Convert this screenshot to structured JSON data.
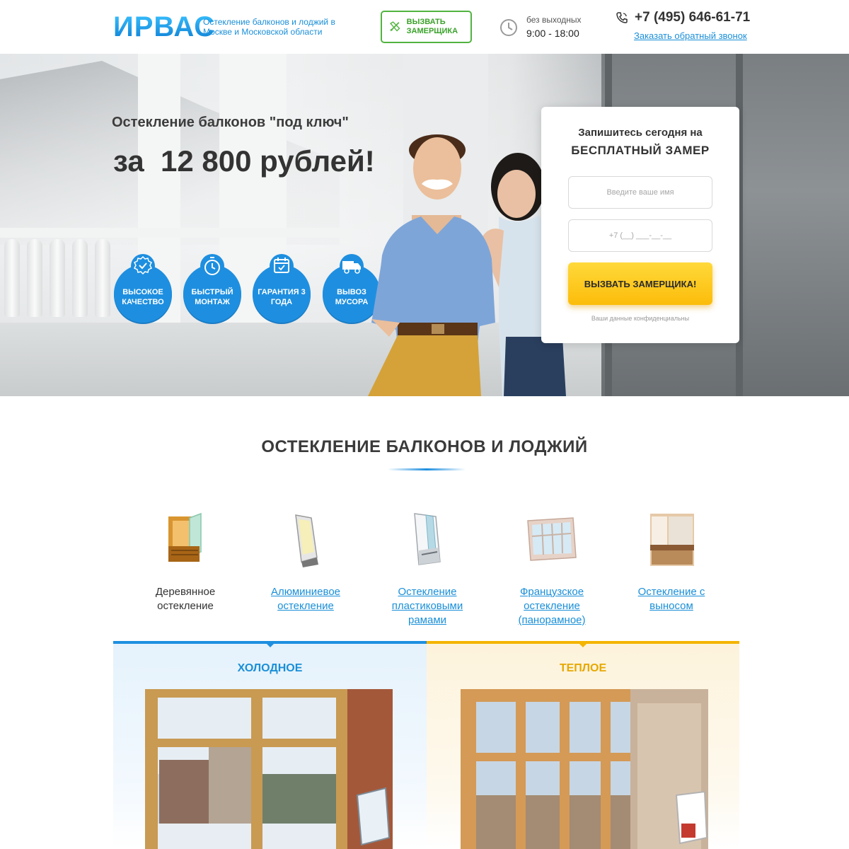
{
  "header": {
    "logo": "ИРВАС",
    "tagline": "Остекление балконов и лоджий в Москве и Московской области",
    "call_button": "Вызвать замерщика",
    "hours_label": "без выходных",
    "hours": "9:00 - 18:00",
    "phone": "+7 (495) 646-61-71",
    "callback": "Заказать обратный звонок"
  },
  "hero": {
    "subtitle": "Остекление балконов \"под ключ\"",
    "title": "за  12 800 рублей!",
    "features": [
      {
        "label": "Высокое качество",
        "icon": "badge-check-icon"
      },
      {
        "label": "Быстрый монтаж",
        "icon": "clock-icon"
      },
      {
        "label": "Гарантия 3 года",
        "icon": "calendar-icon"
      },
      {
        "label": "Вывоз мусора",
        "icon": "truck-icon"
      }
    ]
  },
  "form": {
    "title_line1": "Запишитесь сегодня на",
    "title_line2": "БЕСПЛАТНЫЙ ЗАМЕР",
    "name_placeholder": "Введите ваше имя",
    "phone_placeholder": "+7 (__) ___-__-__",
    "submit": "ВЫЗВАТЬ ЗАМЕРЩИКА!",
    "privacy": "Ваши данные конфиденциальны"
  },
  "section": {
    "title": "ОСТЕКЛЕНИЕ БАЛКОНОВ И ЛОДЖИЙ",
    "types": [
      {
        "label": "Деревянное остекление",
        "active": true
      },
      {
        "label": "Алюминиевое остекление",
        "active": false
      },
      {
        "label": "Остекление пластиковыми рамами",
        "active": false
      },
      {
        "label": "Французское остекление (панорамное)",
        "active": false
      },
      {
        "label": "Остекление с выносом",
        "active": false
      }
    ],
    "tabs": [
      {
        "label": "ХОЛОДНОЕ",
        "color": "#1e8fe0"
      },
      {
        "label": "ТЕПЛОЕ",
        "color": "#f4b400"
      }
    ]
  },
  "colors": {
    "accent_blue": "#1e8fe0",
    "accent_green": "#51b43f",
    "accent_yellow": "#fcbc0a"
  }
}
